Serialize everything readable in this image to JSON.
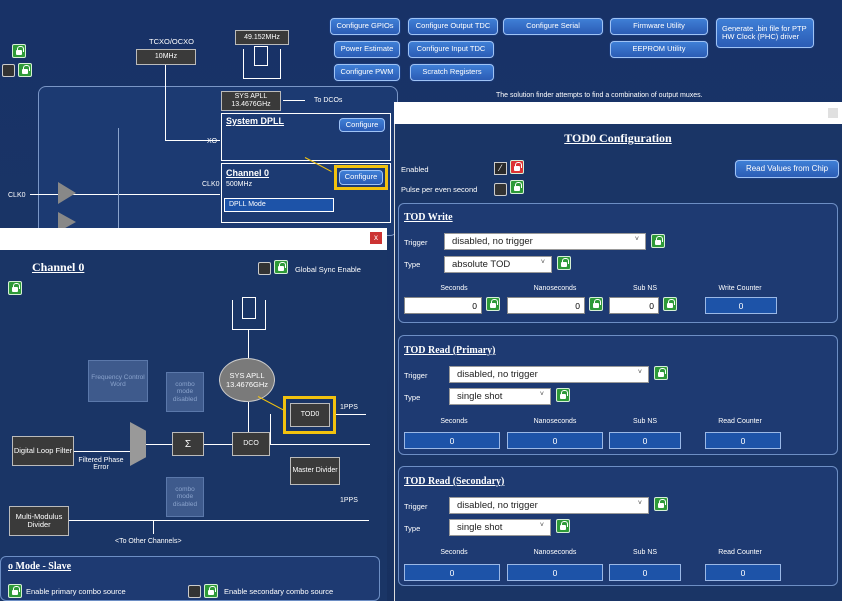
{
  "top": {
    "tcxo_label": "TCXO/OCXO",
    "tcxo_btn": "10MHz",
    "freq_box": "49.152MHz",
    "buttons": [
      "Configure GPIOs",
      "Configure Output TDC",
      "Configure Serial",
      "Firmware Utility",
      "Generate .bin file for PTP HW Clock (PHC) driver",
      "Power Estimate",
      "Configure Input TDC",
      "EEPROM Utility",
      "Configure PWM",
      "Scratch Registers"
    ],
    "sysapll_box": "SYS APLL\n13.4676GHz",
    "to_dcos": "To DCOs",
    "finder_text": "The solution finder attempts to find a combination of output muxes.",
    "system_dpll": "System DPLL",
    "configure": "Configure",
    "xo": "XO",
    "channel0": "Channel 0",
    "freq_500": "500MHz",
    "clk0": "CLK0",
    "clk0_left": "CLK0",
    "dpll_mode": "DPLL Mode"
  },
  "tod": {
    "title": "TOD0 Configuration",
    "enabled": "Enabled",
    "pulse": "Pulse per even second",
    "read_values": "Read Values from Chip",
    "write": {
      "title": "TOD Write",
      "trigger_lbl": "Trigger",
      "trigger": "disabled, no trigger",
      "type_lbl": "Type",
      "type": "absolute TOD",
      "col_seconds": "Seconds",
      "col_ns": "Nanoseconds",
      "col_subns": "Sub NS",
      "col_counter": "Write Counter",
      "v_seconds": "0",
      "v_ns": "0",
      "v_subns": "0",
      "v_counter": "0"
    },
    "read1": {
      "title": "TOD Read (Primary)",
      "trigger_lbl": "Trigger",
      "trigger": "disabled, no trigger",
      "type_lbl": "Type",
      "type": "single shot",
      "col_seconds": "Seconds",
      "col_ns": "Nanoseconds",
      "col_subns": "Sub NS",
      "col_counter": "Read Counter",
      "v_seconds": "0",
      "v_ns": "0",
      "v_subns": "0",
      "v_counter": "0"
    },
    "read2": {
      "title": "TOD Read (Secondary)",
      "trigger_lbl": "Trigger",
      "trigger": "disabled, no trigger",
      "type_lbl": "Type",
      "type": "single shot",
      "col_seconds": "Seconds",
      "col_ns": "Nanoseconds",
      "col_subns": "Sub NS",
      "col_counter": "Read Counter",
      "v_seconds": "0",
      "v_ns": "0",
      "v_subns": "0",
      "v_counter": "0"
    }
  },
  "ch": {
    "title": "Channel 0",
    "global_sync": "Global Sync Enable",
    "close": "x",
    "freq_ctrl": "Frequency Control Word",
    "combo_mode_disabled": "combo mode disabled",
    "sys_apll": "SYS APLL 13.4676GHz",
    "tod0": "TOD0",
    "pps1": "1PPS",
    "pps2": "1PPS",
    "digital_loop": "Digital Loop Filter",
    "filtered": "Filtered Phase Error",
    "sigma": "Σ",
    "dco": "DCO",
    "master_div": "Master Divider",
    "multi_mod": "Multi-Modulus Divider",
    "to_other": "<To Other Channels>",
    "combo_title": "o Mode - Slave",
    "en_primary": "Enable primary combo source",
    "en_secondary": "Enable secondary combo source"
  }
}
